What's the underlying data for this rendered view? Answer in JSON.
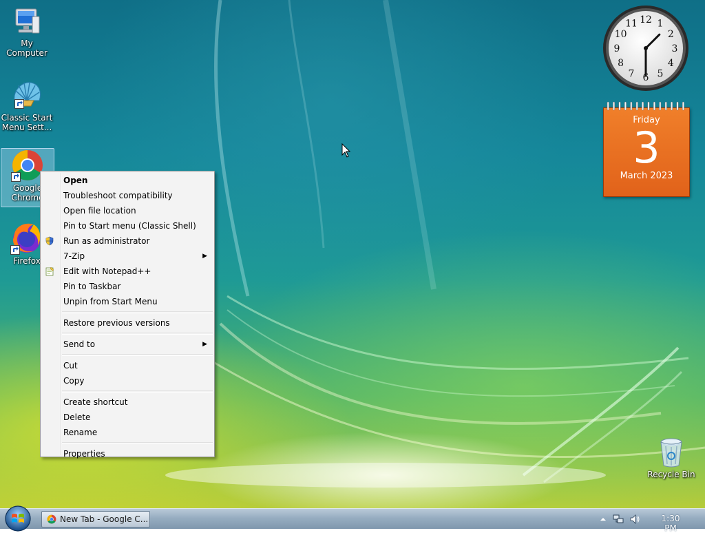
{
  "desktop": {
    "icons": [
      {
        "label": "My Computer"
      },
      {
        "label": "Classic Start Menu Sett..."
      },
      {
        "label": "Google Chrome"
      },
      {
        "label": "Firefox"
      },
      {
        "label": "Recycle Bin"
      }
    ]
  },
  "gadgets": {
    "clock": {
      "hour": 1,
      "minute": 30,
      "numbers": [
        "12",
        "1",
        "2",
        "3",
        "4",
        "5",
        "6",
        "7",
        "8",
        "9",
        "10",
        "11"
      ]
    },
    "calendar": {
      "day_name": "Friday",
      "date": "3",
      "month_year": "March 2023",
      "rings": "ᵎᵎᵎᵎᵎᵎᵎᵎᵎᵎᵎᵎᵎᵎ"
    }
  },
  "context_menu": {
    "items": [
      {
        "label": "Open"
      },
      {
        "label": "Troubleshoot compatibility"
      },
      {
        "label": "Open file location"
      },
      {
        "label": "Pin to Start menu (Classic Shell)"
      },
      {
        "label": "Run as administrator"
      },
      {
        "label": "7-Zip"
      },
      {
        "label": "Edit with Notepad++"
      },
      {
        "label": "Pin to Taskbar"
      },
      {
        "label": "Unpin from Start Menu"
      },
      {
        "label": "Restore previous versions"
      },
      {
        "label": "Send to"
      },
      {
        "label": "Cut"
      },
      {
        "label": "Copy"
      },
      {
        "label": "Create shortcut"
      },
      {
        "label": "Delete"
      },
      {
        "label": "Rename"
      },
      {
        "label": "Properties"
      }
    ]
  },
  "taskbar": {
    "task_button": {
      "label": "New Tab - Google C..."
    },
    "clock": "1:30 PM"
  },
  "colors": {
    "calendar_orange": "#e8701f",
    "menu_background": "#f3f3f3",
    "taskbar_blue": "#97adc1"
  }
}
